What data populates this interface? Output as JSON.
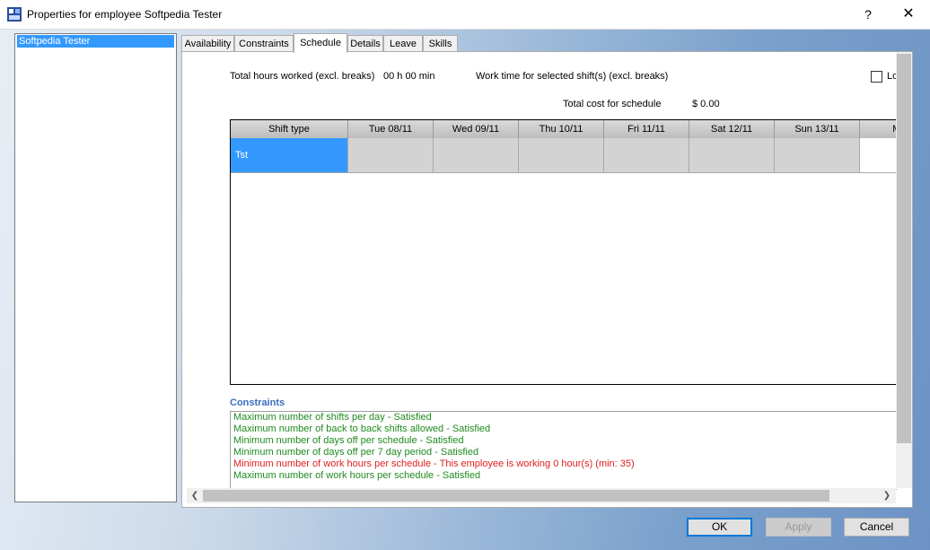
{
  "window": {
    "title": "Properties for employee Softpedia Tester",
    "help_label": "?",
    "close_label": "✕"
  },
  "employees": [
    "Softpedia Tester"
  ],
  "tabs": [
    "Availability",
    "Constraints",
    "Schedule",
    "Details",
    "Leave",
    "Skills"
  ],
  "active_tab": "Schedule",
  "schedule": {
    "total_hours_label": "Total hours worked (excl. breaks)",
    "total_hours_value": "00 h 00 min",
    "work_time_label": "Work time for selected shift(s) (excl. breaks)",
    "total_cost_label": "Total cost for schedule",
    "total_cost_value": "$ 0.00",
    "checkbox_label_fragment": "Lo",
    "columns": [
      "Shift type",
      "Tue 08/11",
      "Wed 09/11",
      "Thu 10/11",
      "Fri 11/11",
      "Sat 12/11",
      "Sun 13/11",
      "Mon"
    ],
    "rows": [
      {
        "shift": "Tst"
      }
    ]
  },
  "constraints": {
    "title": "Constraints",
    "items": [
      {
        "text": "Maximum number of shifts per day - Satisfied",
        "status": "ok"
      },
      {
        "text": "Maximum number of back to back shifts allowed - Satisfied",
        "status": "ok"
      },
      {
        "text": "Minimum number of days off per schedule - Satisfied",
        "status": "ok"
      },
      {
        "text": "Minimum number of days off per 7 day period - Satisfied",
        "status": "ok"
      },
      {
        "text": "Minimum number of work hours per schedule - This employee is working 0 hour(s) (min: 35)",
        "status": "violated"
      },
      {
        "text": "Maximum number of work hours per schedule - Satisfied",
        "status": "ok"
      }
    ]
  },
  "colors": {
    "accent": "#3399ff",
    "ok": "#1f8a1f",
    "violated": "#e02020",
    "constraints_title": "#3a6ec0"
  },
  "buttons": {
    "ok": "OK",
    "apply": "Apply",
    "cancel": "Cancel"
  }
}
